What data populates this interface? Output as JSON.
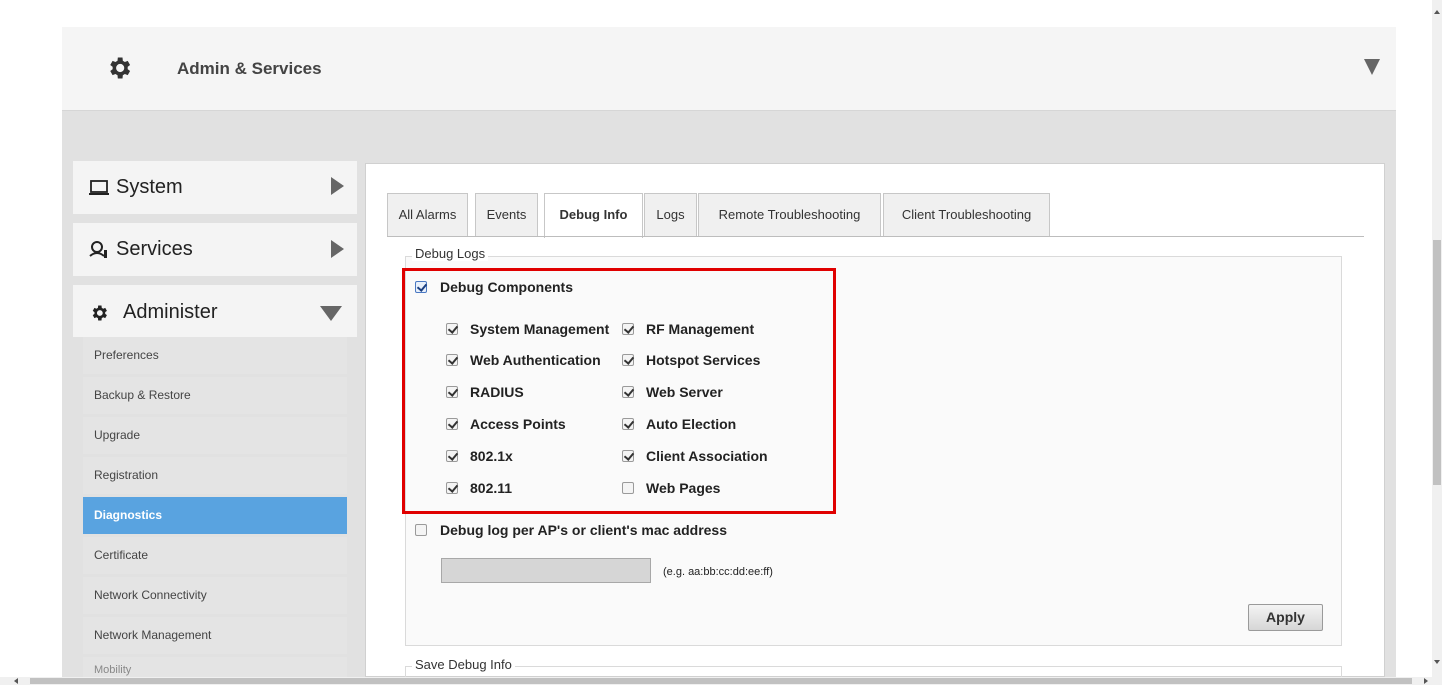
{
  "header": {
    "title": "Admin & Services",
    "icon": "gear-icon"
  },
  "nav": {
    "sections": [
      {
        "label": "System",
        "icon": "laptop-icon",
        "state": "collapsed"
      },
      {
        "label": "Services",
        "icon": "services-icon",
        "state": "collapsed"
      },
      {
        "label": "Administer",
        "icon": "gear-icon",
        "state": "expanded"
      }
    ],
    "items": [
      {
        "label": "Preferences"
      },
      {
        "label": "Backup & Restore"
      },
      {
        "label": "Upgrade"
      },
      {
        "label": "Registration"
      },
      {
        "label": "Diagnostics",
        "active": true
      },
      {
        "label": "Certificate"
      },
      {
        "label": "Network Connectivity"
      },
      {
        "label": "Network Management"
      },
      {
        "label": "Mobility"
      }
    ]
  },
  "tabs": [
    {
      "label": "All Alarms"
    },
    {
      "label": "Events"
    },
    {
      "label": "Debug Info",
      "active": true
    },
    {
      "label": "Logs"
    },
    {
      "label": "Remote Troubleshooting"
    },
    {
      "label": "Client Troubleshooting"
    }
  ],
  "debug_logs": {
    "legend": "Debug Logs",
    "debug_components": {
      "label": "Debug Components",
      "checked": true
    },
    "components": [
      {
        "label": "System Management",
        "checked": true
      },
      {
        "label": "RF Management",
        "checked": true
      },
      {
        "label": "Web Authentication",
        "checked": true
      },
      {
        "label": "Hotspot Services",
        "checked": true
      },
      {
        "label": "RADIUS",
        "checked": true
      },
      {
        "label": "Web Server",
        "checked": true
      },
      {
        "label": "Access Points",
        "checked": true
      },
      {
        "label": "Auto Election",
        "checked": true
      },
      {
        "label": "802.1x",
        "checked": true
      },
      {
        "label": "Client Association",
        "checked": true
      },
      {
        "label": "802.11",
        "checked": true
      },
      {
        "label": "Web Pages",
        "checked": false
      }
    ],
    "mac_filter": {
      "label": "Debug log per AP's or client's mac address",
      "checked": false
    },
    "mac_input": {
      "value": "",
      "hint": "(e.g. aa:bb:cc:dd:ee:ff)"
    },
    "apply_label": "Apply"
  },
  "save_debug": {
    "legend": "Save Debug Info"
  },
  "colors": {
    "active_item": "#59a3e0",
    "highlight": "#e00000"
  }
}
